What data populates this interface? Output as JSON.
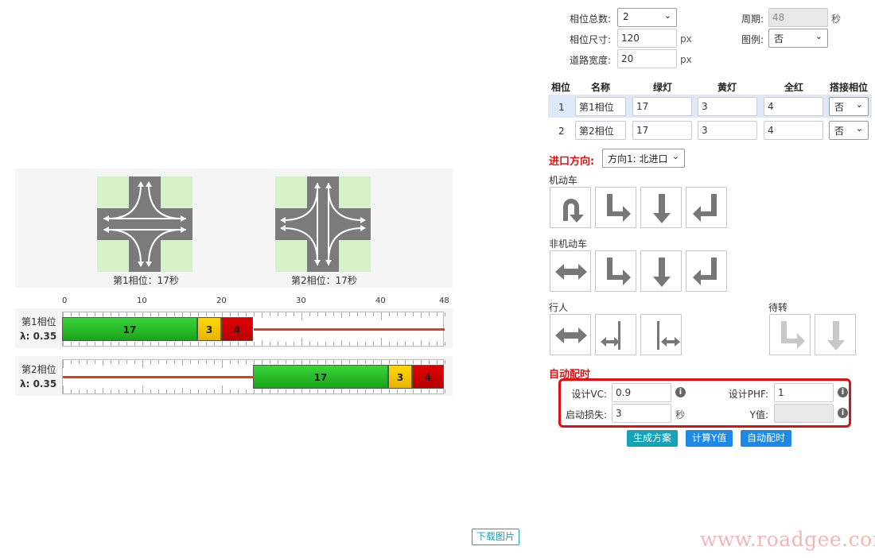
{
  "settings": {
    "phase_total_label": "相位总数:",
    "phase_total_value": "2",
    "phase_size_label": "相位尺寸:",
    "phase_size_value": "120",
    "phase_size_unit": "px",
    "road_width_label": "道路宽度:",
    "road_width_value": "20",
    "road_width_unit": "px",
    "cycle_label": "周期:",
    "cycle_value": "48",
    "cycle_unit": "秒",
    "legend_label": "图例:",
    "legend_value": "否"
  },
  "phase_table": {
    "headers": [
      "相位",
      "名称",
      "绿灯",
      "黄灯",
      "全红",
      "搭接相位"
    ],
    "rows": [
      {
        "index": "1",
        "name": "第1相位",
        "green": "17",
        "yellow": "3",
        "allred": "4",
        "overlap": "否"
      },
      {
        "index": "2",
        "name": "第2相位",
        "green": "17",
        "yellow": "3",
        "allred": "4",
        "overlap": "否"
      }
    ]
  },
  "approach": {
    "label": "进口方向:",
    "value": "方向1: 北进口"
  },
  "movements": {
    "motor_label": "机动车",
    "motor_icons": [
      "u-turn-icon",
      "right-turn-icon",
      "straight-icon",
      "left-turn-icon"
    ],
    "nonmotor_label": "非机动车",
    "nonmotor_icons": [
      "bidirectional-icon",
      "right-turn-icon",
      "straight-icon",
      "left-turn-icon"
    ],
    "ped_label": "行人",
    "ped_icons": [
      "bidirectional-icon",
      "ped-left-icon",
      "ped-right-icon"
    ],
    "waiting_label": "待转",
    "waiting_icons": [
      "right-turn-icon",
      "straight-icon"
    ]
  },
  "auto_timing": {
    "title": "自动配时",
    "vc_label": "设计VC:",
    "vc_value": "0.9",
    "phf_label": "设计PHF:",
    "phf_value": "1",
    "loss_label": "启动损失:",
    "loss_value": "3",
    "loss_unit": "秒",
    "y_label": "Y值:",
    "y_value": "",
    "btn_generate": "生成方案",
    "btn_calc_y": "计算Y值",
    "btn_auto": "自动配时"
  },
  "diagram": {
    "phase1_caption": "第1相位：17秒",
    "phase2_caption": "第2相位：17秒"
  },
  "timing_chart": {
    "ticks": [
      "0",
      "10",
      "20",
      "30",
      "40",
      "48"
    ],
    "tick_values": [
      0,
      10,
      20,
      30,
      40,
      48
    ],
    "cycle": 48,
    "phases": [
      {
        "name": "第1相位",
        "lambda": "λ: 0.35",
        "start": 0,
        "green": 17,
        "yellow": 3,
        "red": 4,
        "green_label": "17",
        "yellow_label": "3",
        "red_label": "4"
      },
      {
        "name": "第2相位",
        "lambda": "λ: 0.35",
        "start": 24,
        "green": 17,
        "yellow": 3,
        "red": 4,
        "green_label": "17",
        "yellow_label": "3",
        "red_label": "4"
      }
    ]
  },
  "download_label": "下载图片",
  "watermark": "www.roadgee.com"
}
